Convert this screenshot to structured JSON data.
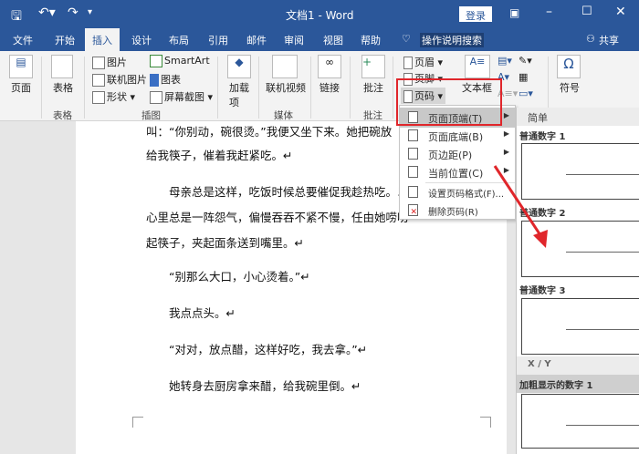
{
  "titlebar": {
    "title": "文档1 - Word",
    "login": "登录",
    "icons": [
      "save-icon",
      "undo-icon",
      "redo-icon",
      "customize-icon",
      "ribbon-display-icon",
      "minimize-icon",
      "maximize-icon",
      "close-icon"
    ]
  },
  "tabs": [
    "文件",
    "开始",
    "插入",
    "设计",
    "布局",
    "引用",
    "邮件",
    "审阅",
    "视图",
    "帮助"
  ],
  "tell_me": "操作说明搜索",
  "share": "共享",
  "ribbon": {
    "page": "页面",
    "table": "表格",
    "picture": "图片",
    "online_picture": "联机图片",
    "shapes": "形状",
    "smartart": "SmartArt",
    "chart": "图表",
    "screenshot": "屏幕截图",
    "addins": "加载项",
    "online_video": "联机视频",
    "link": "链接",
    "comment": "批注",
    "header": "页眉",
    "footer": "页脚",
    "page_number": "页码",
    "textbox": "文本框",
    "symbol": "符号",
    "groups": {
      "table": "表格",
      "illustrations": "插图",
      "media": "媒体",
      "comments": "批注"
    }
  },
  "menu": [
    {
      "label": "页面顶端(T)",
      "submenu": true,
      "active": true
    },
    {
      "label": "页面底端(B)",
      "submenu": true
    },
    {
      "label": "页边距(P)",
      "submenu": true
    },
    {
      "label": "当前位置(C)",
      "submenu": true
    },
    {
      "label": "设置页码格式(F)...",
      "submenu": false
    },
    {
      "label": "删除页码(R)",
      "submenu": false
    }
  ],
  "gallery": {
    "section1": "简单",
    "items": [
      "普通数字 1",
      "普通数字 2",
      "普通数字 3"
    ],
    "section2": "X / Y",
    "item4": "加粗显示的数字 1"
  },
  "document": {
    "lines": [
      "叫：“你别动，碗很烫。”我便又坐下来。她把碗放",
      "给我筷子，催着我赶紧吃。↵",
      "母亲总是这样，吃饭时候总要催促我趁热吃。以",
      "心里总是一阵怨气，偏慢吞吞不紧不慢，任由她唠叨",
      "起筷子，夹起面条送到嘴里。↵",
      "“别那么大口，小心烫着。”↵",
      "我点点头。↵",
      "“对对，放点醋，这样好吃，我去拿。”↵",
      "她转身去厨房拿来醋，给我碗里倒。↵"
    ]
  },
  "colors": {
    "brand": "#2b579a",
    "highlight": "#e0262b"
  }
}
